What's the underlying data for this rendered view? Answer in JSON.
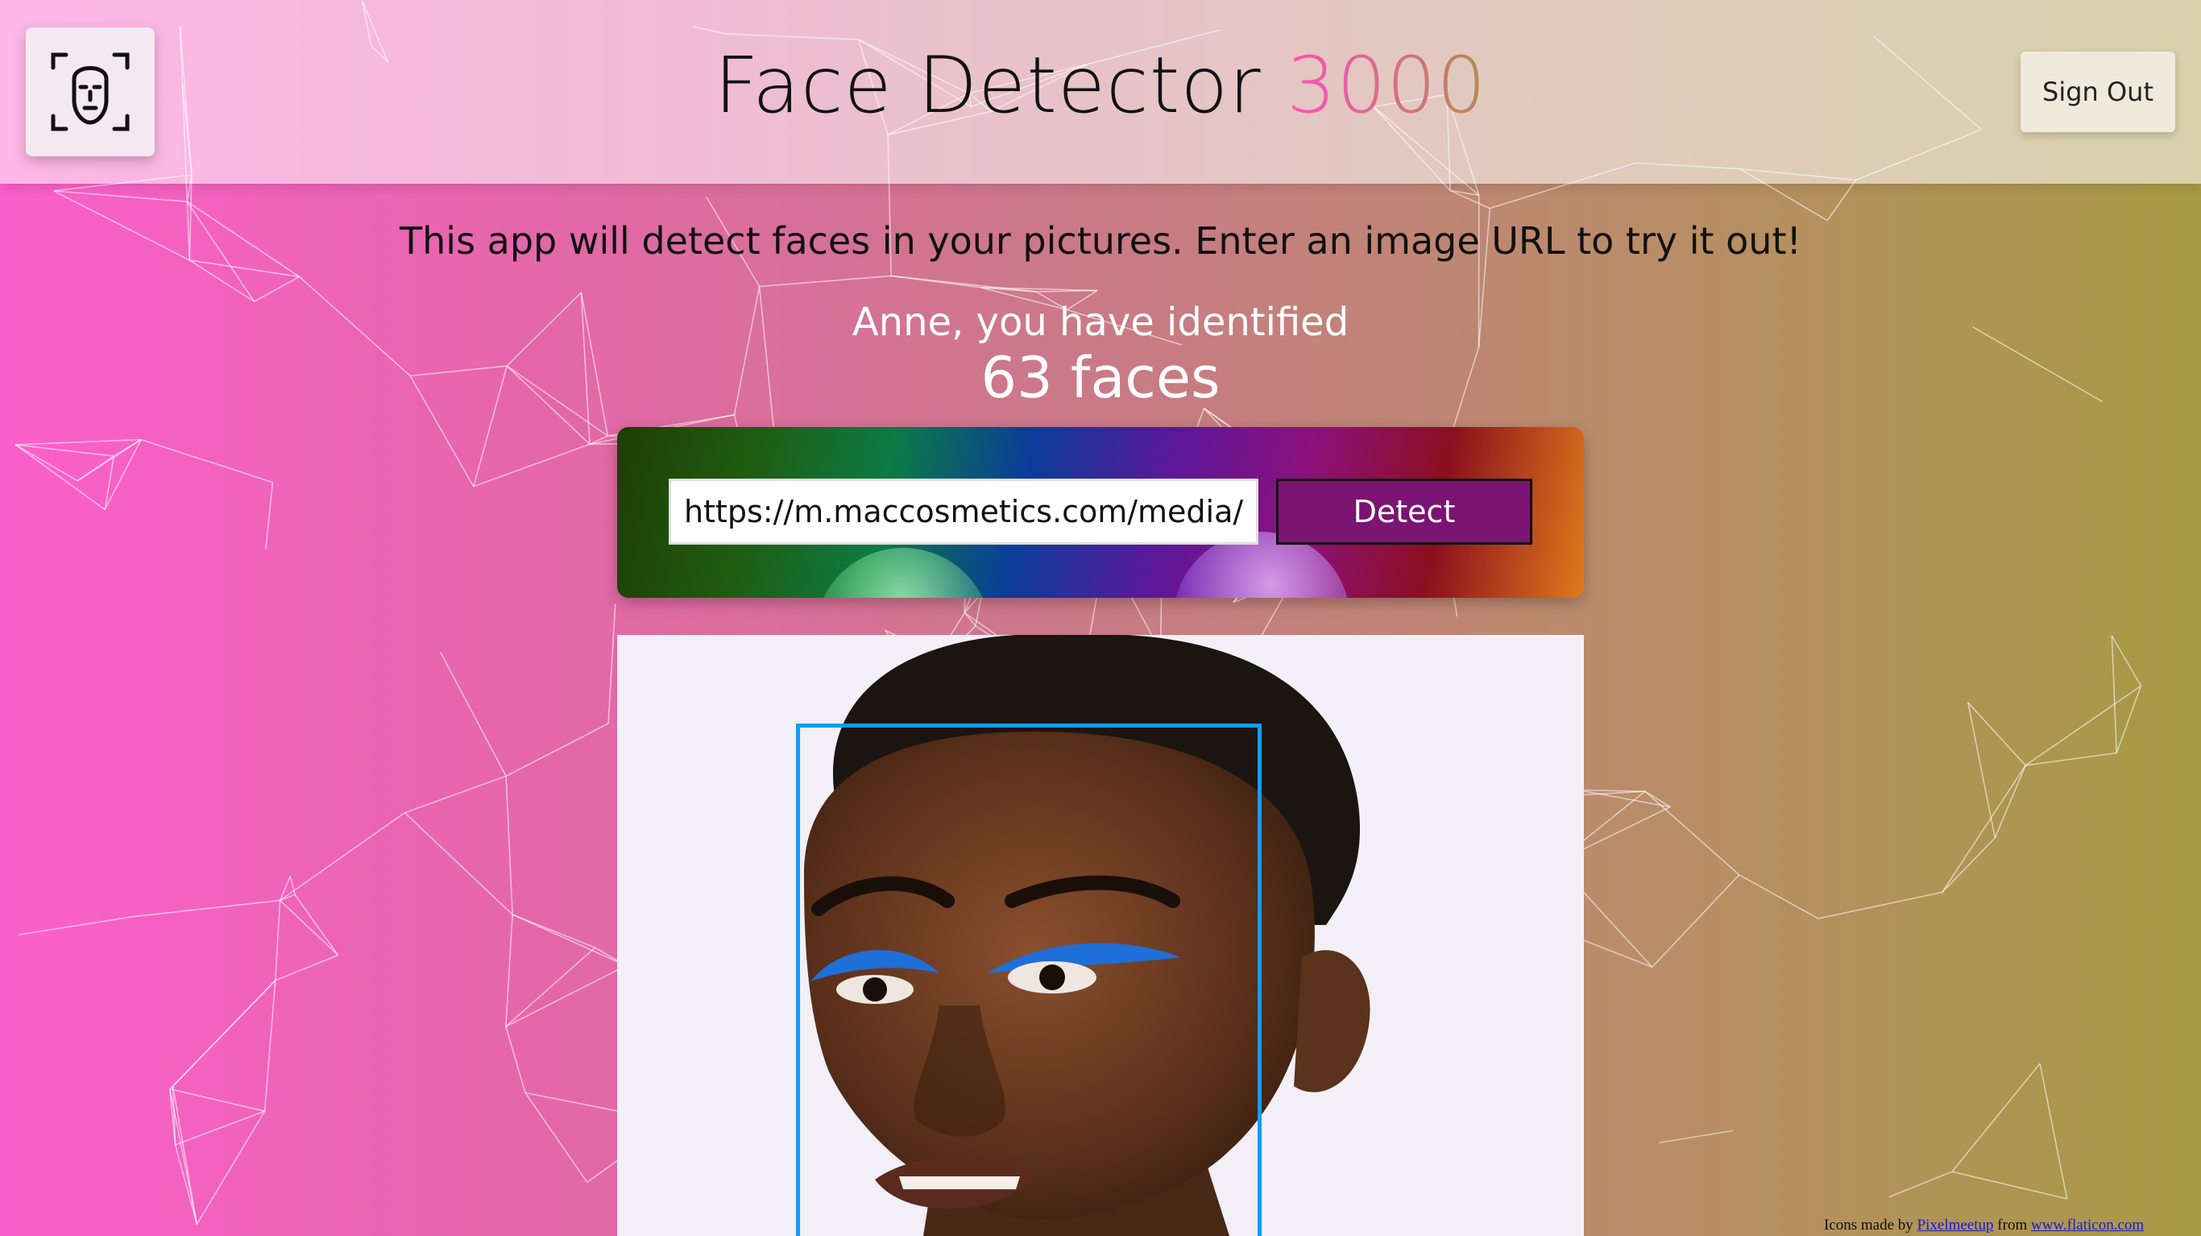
{
  "header": {
    "title_main": "Face Detector",
    "title_accent": "3000",
    "logo_icon": "face-scan-icon",
    "signout_label": "Sign Out"
  },
  "main": {
    "intro": "This app will detect faces in your pictures. Enter an image URL to try it out!",
    "rank_line": "Anne, you have identified",
    "rank_count": "63 faces"
  },
  "form": {
    "url_value": "https://m.maccosmetics.com/media/e",
    "detect_label": "Detect"
  },
  "result": {
    "image_description_icon": "portrait-photo",
    "face_box_color": "#149df2"
  },
  "footer": {
    "prefix": "Icons made by",
    "author": "Pixelmeetup",
    "middle": "from",
    "site": "www.flaticon.com"
  },
  "colors": {
    "background_left": "#fb5fcb",
    "background_right": "#a89a44",
    "detect_button": "#7b1473"
  }
}
